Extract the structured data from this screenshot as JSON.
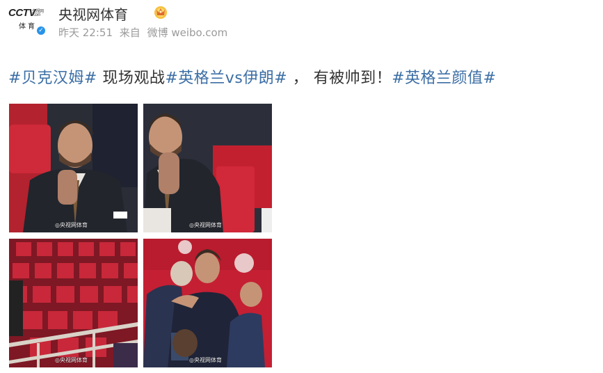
{
  "author": {
    "avatar": {
      "logo_text": "CCTV",
      "logo_cn": "央视网",
      "logo_com": "com",
      "logo_sub": "体育"
    },
    "name": "央视网体育",
    "badge_icon": "crown-icon"
  },
  "meta": {
    "time": "昨天 22:51",
    "from": "来自",
    "source": "微博 weibo.com"
  },
  "post": {
    "tag1": "#贝克汉姆#",
    "text1": " 现场观战",
    "tag2": "#英格兰vs伊朗#",
    "text2": " ， 有被帅到！",
    "tag3": "#英格兰颜值#"
  },
  "images": [
    {
      "watermark": "◎央视网体育"
    },
    {
      "watermark": "◎央视网体育"
    },
    {
      "watermark": "◎央视网体育"
    },
    {
      "watermark": "◎央视网体育"
    }
  ],
  "colors": {
    "hashtag": "#3b6ea5",
    "meta_gray": "#9a9a9a",
    "verify_blue": "#2a93e8",
    "seat_red": "#c8283a"
  }
}
